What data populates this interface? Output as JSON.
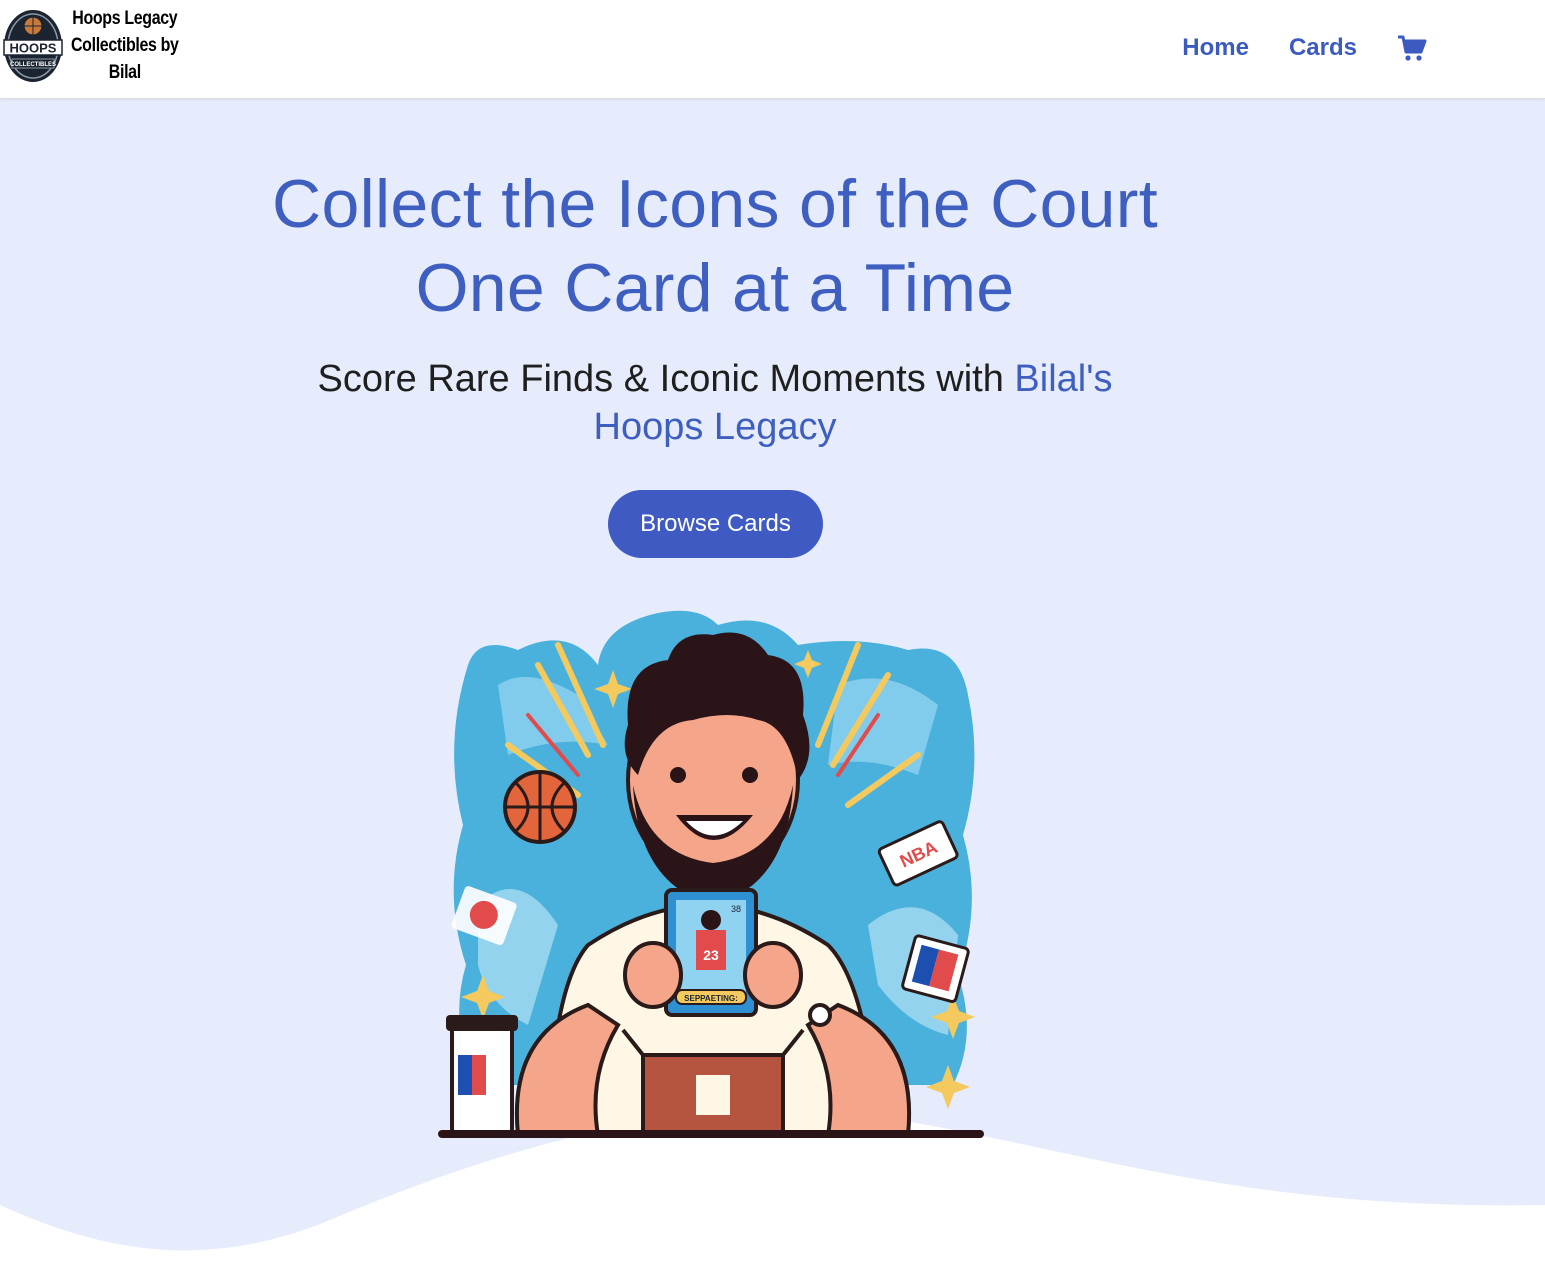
{
  "nav": {
    "brand_text": "Hoops Legacy Collectibles by Bilal",
    "logo_text": "HOOPS",
    "logo_subtext": "COLLECTIBLES",
    "links": [
      {
        "label": "Home"
      },
      {
        "label": "Cards"
      }
    ],
    "cart_icon": "shopping-cart-icon"
  },
  "hero": {
    "title": "Collect the Icons of the Court One Card at a Time",
    "subtitle_prefix": "Score Rare Finds & Iconic Moments with ",
    "subtitle_accent": "Bilal's Hoops Legacy",
    "button_label": "Browse Cards"
  },
  "illustration": {
    "card_number": "23",
    "card_corner": "38",
    "card_banner": "SEPPAETING:",
    "ticket_text": "NBA"
  },
  "colors": {
    "accent": "#3f5fc0",
    "button": "#3f5bc3",
    "background": "#e6ecfb"
  }
}
